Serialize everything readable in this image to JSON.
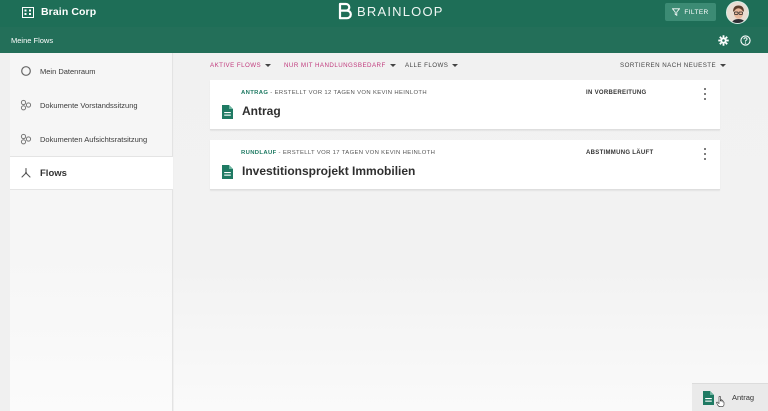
{
  "header": {
    "company": "Brain Corp",
    "brand": "BRAINLOOP",
    "filter_label": "FILTER"
  },
  "subheader": {
    "title": "Meine Flows"
  },
  "sidebar": {
    "items": [
      {
        "label": "Mein Datenraum",
        "icon": "circle-outline-icon"
      },
      {
        "label": "Dokumente Vorstandssitzung",
        "icon": "group-icon"
      },
      {
        "label": "Dokumenten Aufsichtsratsitzung",
        "icon": "group-icon"
      },
      {
        "label": "Flows",
        "icon": "flows-icon",
        "active": true
      }
    ]
  },
  "filters": {
    "active_flows": "AKTIVE FLOWS",
    "needs_action": "NUR MIT HANDLUNGSBEDARF",
    "all_flows": "ALLE FLOWS",
    "sort": "SORTIEREN NACH NEUESTE"
  },
  "flows": [
    {
      "kind": "ANTRAG",
      "meta": "- ERSTELLT VOR 12 TAGEN VON KEVIN HEINLOTH",
      "status": "IN VORBEREITUNG",
      "title": "Antrag"
    },
    {
      "kind": "RUNDLAUF",
      "meta": "- ERSTELLT VOR 17 TAGEN VON KEVIN HEINLOTH",
      "status": "ABSTIMMUNG LÄUFT",
      "title": "Investitionsprojekt Immobilien"
    }
  ],
  "tooltip": {
    "label": "Antrag"
  },
  "colors": {
    "header": "#1e6e57",
    "accent_pink": "#c13a7d",
    "accent_green": "#1f7a63"
  }
}
